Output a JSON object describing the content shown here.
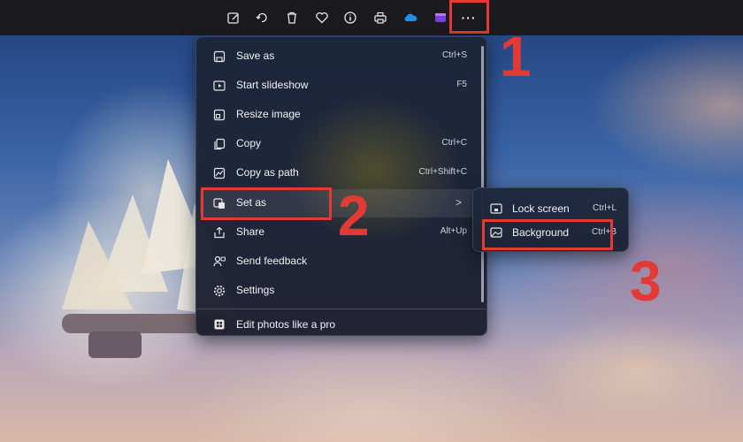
{
  "toolbar": {
    "icons": [
      "edit-image-icon",
      "rotate-icon",
      "delete-icon",
      "favorite-icon",
      "info-icon",
      "print-icon",
      "onedrive-icon",
      "clipchamp-icon",
      "more-options-icon"
    ],
    "more_symbol": "···"
  },
  "menu": {
    "items": [
      {
        "label": "Save as",
        "shortcut": "Ctrl+S",
        "icon": "save-icon"
      },
      {
        "label": "Start slideshow",
        "shortcut": "F5",
        "icon": "slideshow-icon"
      },
      {
        "label": "Resize image",
        "shortcut": "",
        "icon": "resize-icon"
      },
      {
        "label": "Copy",
        "shortcut": "Ctrl+C",
        "icon": "copy-icon"
      },
      {
        "label": "Copy as path",
        "shortcut": "Ctrl+Shift+C",
        "icon": "copy-path-icon"
      },
      {
        "label": "Set as",
        "shortcut": "",
        "icon": "set-as-icon",
        "chevron": ">"
      },
      {
        "label": "Share",
        "shortcut": "Alt+Up",
        "icon": "share-icon"
      },
      {
        "label": "Send feedback",
        "shortcut": "",
        "icon": "feedback-icon"
      },
      {
        "label": "Settings",
        "shortcut": "",
        "icon": "settings-icon"
      },
      {
        "label": "Edit photos like a pro",
        "shortcut": "",
        "icon": "edit-pro-icon"
      }
    ]
  },
  "submenu": {
    "items": [
      {
        "label": "Lock screen",
        "shortcut": "Ctrl+L",
        "icon": "lock-screen-icon"
      },
      {
        "label": "Background",
        "shortcut": "Ctrl+B",
        "icon": "background-icon"
      }
    ]
  },
  "annotations": {
    "step1": "1",
    "step2": "2",
    "step3": "3",
    "color": "#e43a36"
  }
}
